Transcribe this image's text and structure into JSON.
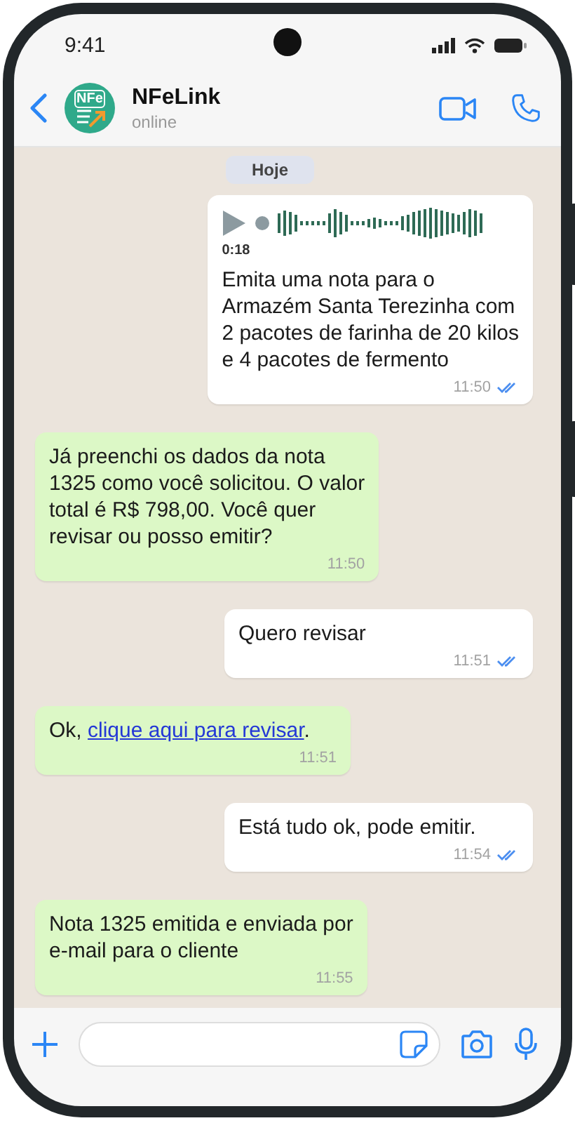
{
  "status_bar": {
    "time": "9:41"
  },
  "contact": {
    "avatar_text": "NFe",
    "name": "NFeLink",
    "status": "online"
  },
  "date_chip": "Hoje",
  "messages": [
    {
      "kind": "voice",
      "sent": true,
      "duration": "0:18",
      "lines": [
        "Emita uma nota para o",
        "Armazém Santa Terezinha com",
        "2 pacotes de farinha de 20 kilos",
        "e 4 pacotes de fermento"
      ],
      "time": "11:50",
      "read": true
    },
    {
      "kind": "text",
      "sent": false,
      "lines": [
        "Já preenchi os dados da nota",
        "1325 como você solicitou. O valor",
        "total é R$ 798,00. Você quer",
        "revisar ou posso emitir?"
      ],
      "time": "11:50"
    },
    {
      "kind": "text",
      "sent": true,
      "lines": [
        "Quero revisar"
      ],
      "time": "11:51",
      "read": true
    },
    {
      "kind": "link",
      "sent": false,
      "before": "Ok, ",
      "link": "clique aqui para revisar",
      "after": ".",
      "time": "11:51"
    },
    {
      "kind": "text",
      "sent": true,
      "lines": [
        "Está tudo ok, pode emitir."
      ],
      "time": "11:54",
      "read": true
    },
    {
      "kind": "text",
      "sent": false,
      "lines": [
        "Nota 1325 emitida e enviada por",
        "e-mail para o cliente"
      ],
      "time": "11:55"
    }
  ]
}
